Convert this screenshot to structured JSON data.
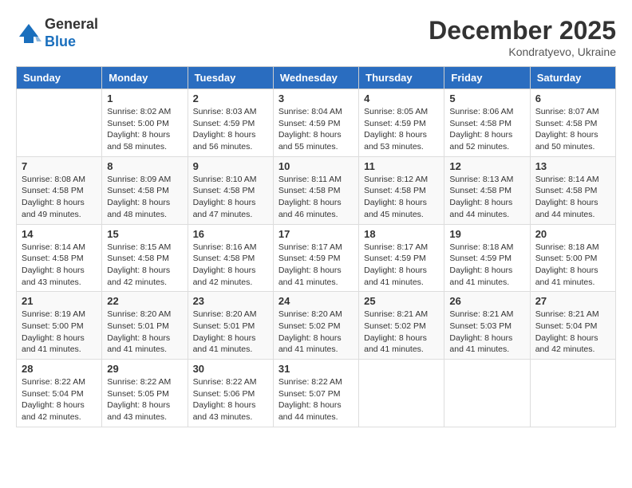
{
  "header": {
    "logo_line1": "General",
    "logo_line2": "Blue",
    "month_title": "December 2025",
    "location": "Kondratyevo, Ukraine"
  },
  "weekdays": [
    "Sunday",
    "Monday",
    "Tuesday",
    "Wednesday",
    "Thursday",
    "Friday",
    "Saturday"
  ],
  "weeks": [
    [
      {
        "day": "",
        "sunrise": "",
        "sunset": "",
        "daylight": ""
      },
      {
        "day": "1",
        "sunrise": "Sunrise: 8:02 AM",
        "sunset": "Sunset: 5:00 PM",
        "daylight": "Daylight: 8 hours and 58 minutes."
      },
      {
        "day": "2",
        "sunrise": "Sunrise: 8:03 AM",
        "sunset": "Sunset: 4:59 PM",
        "daylight": "Daylight: 8 hours and 56 minutes."
      },
      {
        "day": "3",
        "sunrise": "Sunrise: 8:04 AM",
        "sunset": "Sunset: 4:59 PM",
        "daylight": "Daylight: 8 hours and 55 minutes."
      },
      {
        "day": "4",
        "sunrise": "Sunrise: 8:05 AM",
        "sunset": "Sunset: 4:59 PM",
        "daylight": "Daylight: 8 hours and 53 minutes."
      },
      {
        "day": "5",
        "sunrise": "Sunrise: 8:06 AM",
        "sunset": "Sunset: 4:58 PM",
        "daylight": "Daylight: 8 hours and 52 minutes."
      },
      {
        "day": "6",
        "sunrise": "Sunrise: 8:07 AM",
        "sunset": "Sunset: 4:58 PM",
        "daylight": "Daylight: 8 hours and 50 minutes."
      }
    ],
    [
      {
        "day": "7",
        "sunrise": "Sunrise: 8:08 AM",
        "sunset": "Sunset: 4:58 PM",
        "daylight": "Daylight: 8 hours and 49 minutes."
      },
      {
        "day": "8",
        "sunrise": "Sunrise: 8:09 AM",
        "sunset": "Sunset: 4:58 PM",
        "daylight": "Daylight: 8 hours and 48 minutes."
      },
      {
        "day": "9",
        "sunrise": "Sunrise: 8:10 AM",
        "sunset": "Sunset: 4:58 PM",
        "daylight": "Daylight: 8 hours and 47 minutes."
      },
      {
        "day": "10",
        "sunrise": "Sunrise: 8:11 AM",
        "sunset": "Sunset: 4:58 PM",
        "daylight": "Daylight: 8 hours and 46 minutes."
      },
      {
        "day": "11",
        "sunrise": "Sunrise: 8:12 AM",
        "sunset": "Sunset: 4:58 PM",
        "daylight": "Daylight: 8 hours and 45 minutes."
      },
      {
        "day": "12",
        "sunrise": "Sunrise: 8:13 AM",
        "sunset": "Sunset: 4:58 PM",
        "daylight": "Daylight: 8 hours and 44 minutes."
      },
      {
        "day": "13",
        "sunrise": "Sunrise: 8:14 AM",
        "sunset": "Sunset: 4:58 PM",
        "daylight": "Daylight: 8 hours and 44 minutes."
      }
    ],
    [
      {
        "day": "14",
        "sunrise": "Sunrise: 8:14 AM",
        "sunset": "Sunset: 4:58 PM",
        "daylight": "Daylight: 8 hours and 43 minutes."
      },
      {
        "day": "15",
        "sunrise": "Sunrise: 8:15 AM",
        "sunset": "Sunset: 4:58 PM",
        "daylight": "Daylight: 8 hours and 42 minutes."
      },
      {
        "day": "16",
        "sunrise": "Sunrise: 8:16 AM",
        "sunset": "Sunset: 4:58 PM",
        "daylight": "Daylight: 8 hours and 42 minutes."
      },
      {
        "day": "17",
        "sunrise": "Sunrise: 8:17 AM",
        "sunset": "Sunset: 4:59 PM",
        "daylight": "Daylight: 8 hours and 41 minutes."
      },
      {
        "day": "18",
        "sunrise": "Sunrise: 8:17 AM",
        "sunset": "Sunset: 4:59 PM",
        "daylight": "Daylight: 8 hours and 41 minutes."
      },
      {
        "day": "19",
        "sunrise": "Sunrise: 8:18 AM",
        "sunset": "Sunset: 4:59 PM",
        "daylight": "Daylight: 8 hours and 41 minutes."
      },
      {
        "day": "20",
        "sunrise": "Sunrise: 8:18 AM",
        "sunset": "Sunset: 5:00 PM",
        "daylight": "Daylight: 8 hours and 41 minutes."
      }
    ],
    [
      {
        "day": "21",
        "sunrise": "Sunrise: 8:19 AM",
        "sunset": "Sunset: 5:00 PM",
        "daylight": "Daylight: 8 hours and 41 minutes."
      },
      {
        "day": "22",
        "sunrise": "Sunrise: 8:20 AM",
        "sunset": "Sunset: 5:01 PM",
        "daylight": "Daylight: 8 hours and 41 minutes."
      },
      {
        "day": "23",
        "sunrise": "Sunrise: 8:20 AM",
        "sunset": "Sunset: 5:01 PM",
        "daylight": "Daylight: 8 hours and 41 minutes."
      },
      {
        "day": "24",
        "sunrise": "Sunrise: 8:20 AM",
        "sunset": "Sunset: 5:02 PM",
        "daylight": "Daylight: 8 hours and 41 minutes."
      },
      {
        "day": "25",
        "sunrise": "Sunrise: 8:21 AM",
        "sunset": "Sunset: 5:02 PM",
        "daylight": "Daylight: 8 hours and 41 minutes."
      },
      {
        "day": "26",
        "sunrise": "Sunrise: 8:21 AM",
        "sunset": "Sunset: 5:03 PM",
        "daylight": "Daylight: 8 hours and 41 minutes."
      },
      {
        "day": "27",
        "sunrise": "Sunrise: 8:21 AM",
        "sunset": "Sunset: 5:04 PM",
        "daylight": "Daylight: 8 hours and 42 minutes."
      }
    ],
    [
      {
        "day": "28",
        "sunrise": "Sunrise: 8:22 AM",
        "sunset": "Sunset: 5:04 PM",
        "daylight": "Daylight: 8 hours and 42 minutes."
      },
      {
        "day": "29",
        "sunrise": "Sunrise: 8:22 AM",
        "sunset": "Sunset: 5:05 PM",
        "daylight": "Daylight: 8 hours and 43 minutes."
      },
      {
        "day": "30",
        "sunrise": "Sunrise: 8:22 AM",
        "sunset": "Sunset: 5:06 PM",
        "daylight": "Daylight: 8 hours and 43 minutes."
      },
      {
        "day": "31",
        "sunrise": "Sunrise: 8:22 AM",
        "sunset": "Sunset: 5:07 PM",
        "daylight": "Daylight: 8 hours and 44 minutes."
      },
      {
        "day": "",
        "sunrise": "",
        "sunset": "",
        "daylight": ""
      },
      {
        "day": "",
        "sunrise": "",
        "sunset": "",
        "daylight": ""
      },
      {
        "day": "",
        "sunrise": "",
        "sunset": "",
        "daylight": ""
      }
    ]
  ]
}
